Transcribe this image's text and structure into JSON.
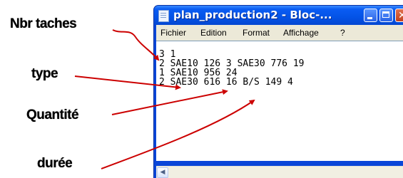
{
  "annotations": {
    "nbr_taches": "Nbr taches",
    "type": "type",
    "quantite": "Quantité",
    "duree": "durée"
  },
  "window": {
    "title": "plan_production2 - Bloc-...",
    "icon": "notepad-icon",
    "controls": [
      "minimize-icon",
      "maximize-icon",
      "close-icon"
    ]
  },
  "menu": {
    "items": [
      "Fichier",
      "Edition",
      "Format",
      "Affichage",
      "?"
    ]
  },
  "editor": {
    "lines": [
      "3 1",
      "2 SAE10 126 3 SAE30 776 19",
      "1 SAE10 956 24",
      "2 SAE30 616 16 B/S 149 4"
    ]
  },
  "colors": {
    "titlebar": "#0a5cf3",
    "arrow": "#cc0000",
    "menubar_bg": "#ece9d8"
  }
}
